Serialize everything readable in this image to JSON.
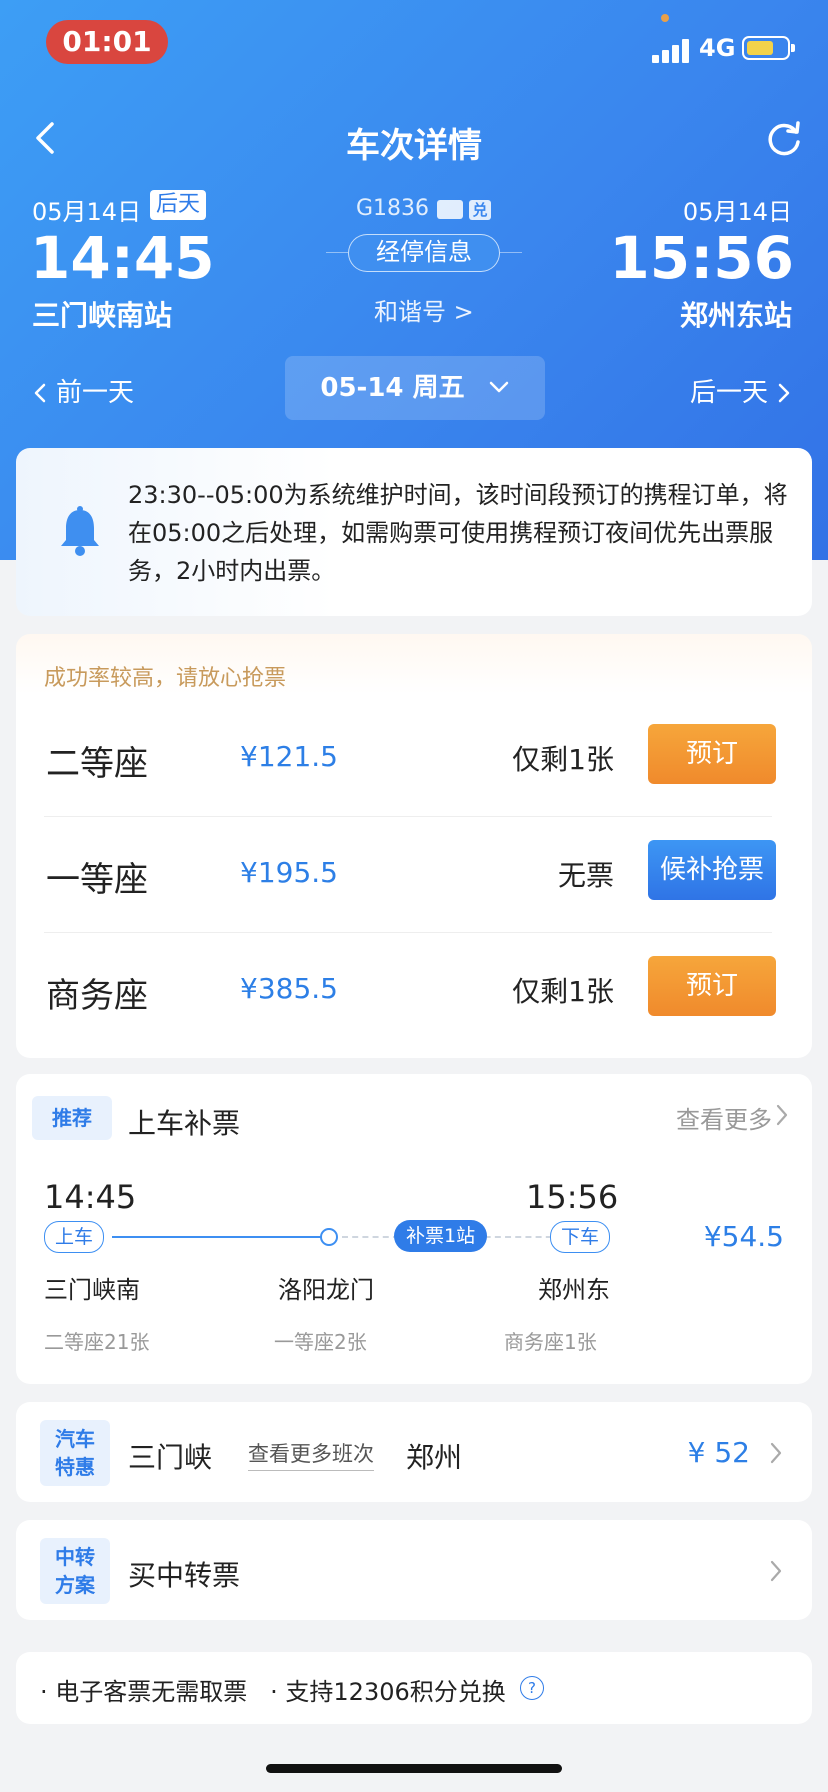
{
  "status_bar": {
    "time": "01:01",
    "network": "4G"
  },
  "nav": {
    "title": "车次详情"
  },
  "train": {
    "number": "G1836",
    "dui_icon_text": "兑",
    "departure": {
      "date": "05月14日",
      "day_tag": "后天",
      "time": "14:45",
      "station": "三门峡南站"
    },
    "arrival": {
      "date": "05月14日",
      "time": "15:56",
      "station": "郑州东站"
    },
    "stops_label": "经停信息",
    "type_label": "和谐号 >"
  },
  "date_bar": {
    "prev": "前一天",
    "current": "05-14 周五",
    "next": "后一天"
  },
  "notice": {
    "text": "23:30--05:00为系统维护时间，该时间段预订的携程订单，将在05:00之后处理，如需购票可使用携程预订夜间优先出票服务，2小时内出票。"
  },
  "seats": {
    "tip": "成功率较高，请放心抢票",
    "rows": [
      {
        "name": "二等座",
        "price": "¥121.5",
        "availability": "仅剩1张",
        "action": "预订",
        "style": "orange"
      },
      {
        "name": "一等座",
        "price": "¥195.5",
        "availability": "无票",
        "action": "候补抢票",
        "style": "blue"
      },
      {
        "name": "商务座",
        "price": "¥385.5",
        "availability": "仅剩1张",
        "action": "预订",
        "style": "orange"
      }
    ]
  },
  "recommend": {
    "badge": "推荐",
    "title": "上车补票",
    "more": "查看更多",
    "depart_time": "14:45",
    "arrive_time": "15:56",
    "board_tag": "上车",
    "fill_tag": "补票1站",
    "alight_tag": "下车",
    "price": "¥54.5",
    "stations": [
      "三门峡南",
      "洛阳龙门",
      "郑州东"
    ],
    "seat_info": [
      "二等座21张",
      "一等座2张",
      "商务座1张"
    ]
  },
  "bus": {
    "badge_line1": "汽车",
    "badge_line2": "特惠",
    "from": "三门峡",
    "more": "查看更多班次",
    "to": "郑州",
    "price": "¥ 52"
  },
  "transfer": {
    "badge_line1": "中转",
    "badge_line2": "方案",
    "title": "买中转票"
  },
  "footer": {
    "text": "· 电子客票无需取票   · 支持12306积分兑换",
    "help_icon": "?"
  },
  "colors": {
    "header_blue": "#3a86ee",
    "accent_blue": "#2d7fe6",
    "orange": "#f08a2c",
    "status_red": "#d9463f"
  }
}
